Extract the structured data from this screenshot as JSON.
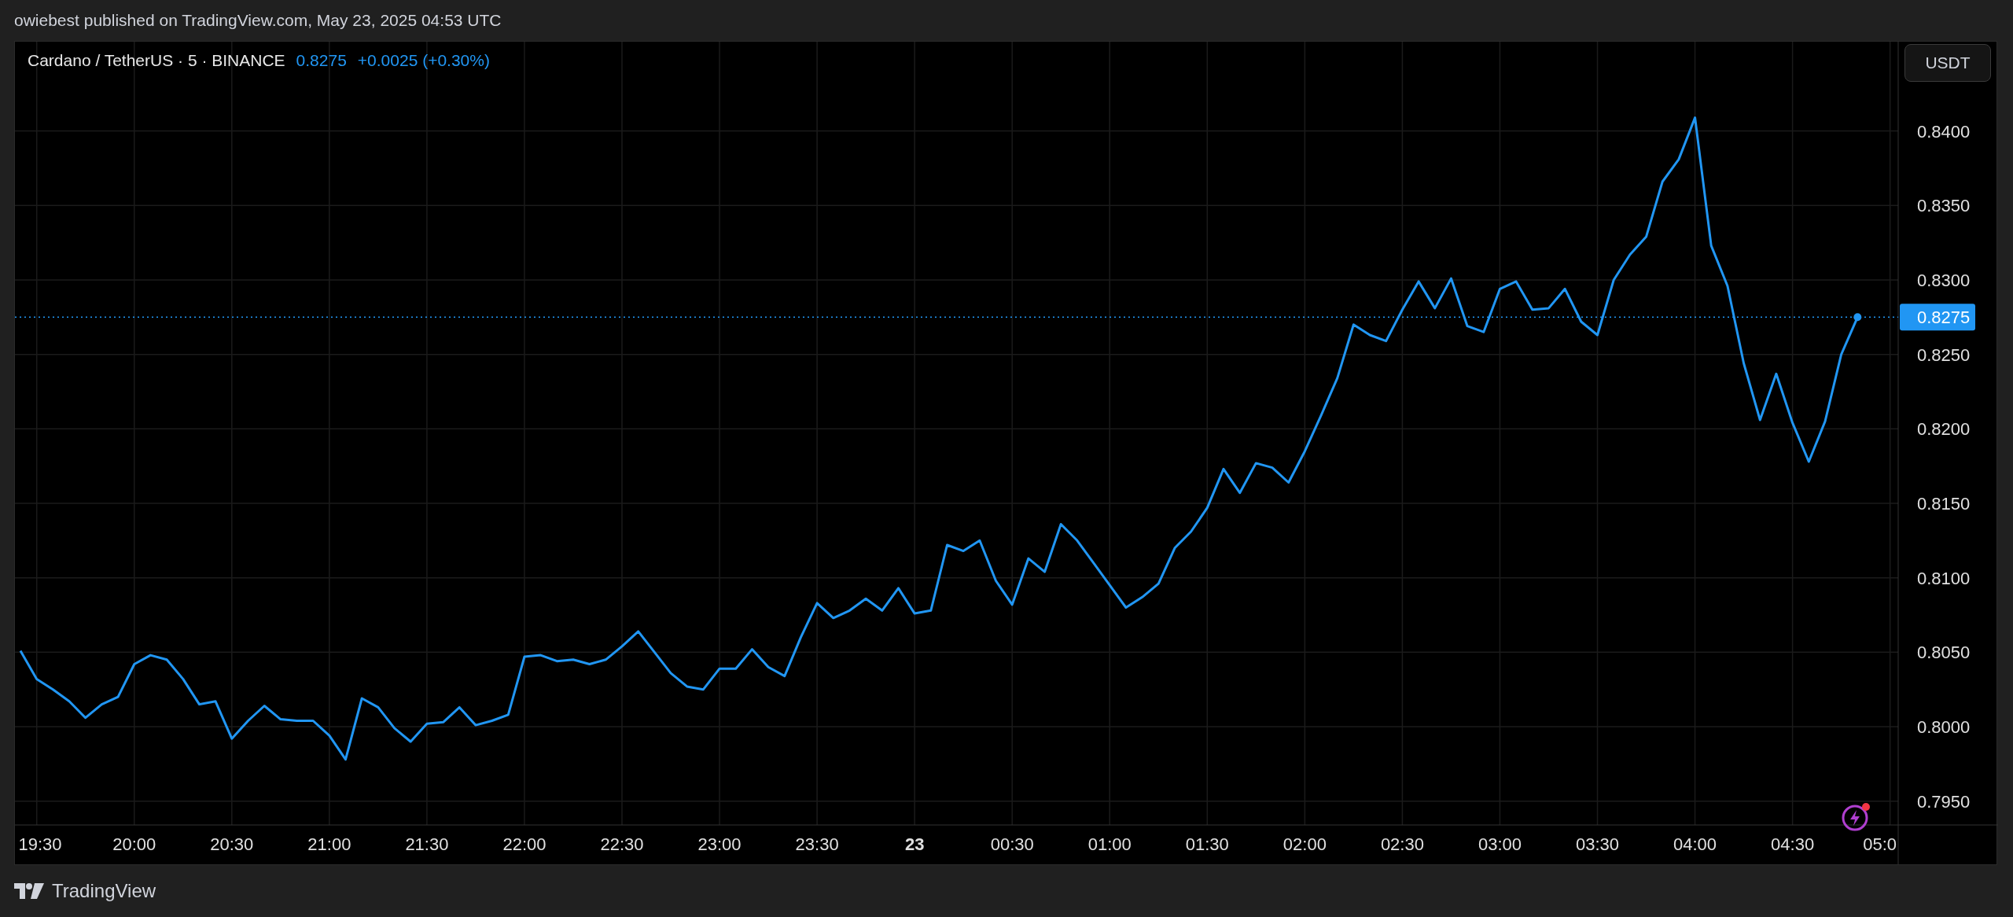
{
  "header": {
    "text": "owiebest published on TradingView.com, May 23, 2025 04:53 UTC"
  },
  "legend": {
    "symbol": "Cardano / TetherUS · 5 · BINANCE",
    "price": "0.8275",
    "change": "+0.0025 (+0.30%)"
  },
  "currency_button": "USDT",
  "chart": {
    "chart_data": {
      "type": "line",
      "grid": true,
      "categories": [
        null,
        "19:30",
        null,
        null,
        null,
        null,
        null,
        "20:00",
        null,
        null,
        null,
        null,
        null,
        "20:30",
        null,
        null,
        null,
        null,
        null,
        "21:00",
        null,
        null,
        null,
        null,
        null,
        "21:30",
        null,
        null,
        null,
        null,
        null,
        "22:00",
        null,
        null,
        null,
        null,
        null,
        "22:30",
        null,
        null,
        null,
        null,
        null,
        "23:00",
        null,
        null,
        null,
        null,
        null,
        "23:30",
        null,
        null,
        null,
        null,
        null,
        "23",
        null,
        null,
        null,
        null,
        null,
        "00:30",
        null,
        null,
        null,
        null,
        null,
        "01:00",
        null,
        null,
        null,
        null,
        null,
        "01:30",
        null,
        null,
        null,
        null,
        null,
        "02:00",
        null,
        null,
        null,
        null,
        null,
        "02:30",
        null,
        null,
        null,
        null,
        null,
        "03:00",
        null,
        null,
        null,
        null,
        null,
        "03:30",
        null,
        null,
        null,
        null,
        null,
        "04:00",
        null,
        null,
        null,
        null,
        null,
        "04:30",
        null,
        null,
        null,
        null,
        null,
        "05:0"
      ],
      "ylim": [
        0.7934,
        0.846
      ],
      "ref_lines": [
        {
          "axis": "y",
          "value": 0.8275,
          "label": "0.8275",
          "color": "#2196f3"
        }
      ],
      "series": [
        {
          "color": "#2196f3",
          "values": [
            0.8051,
            0.8032,
            0.8025,
            0.8017,
            0.8006,
            0.8015,
            0.802,
            0.8042,
            0.8048,
            0.8045,
            0.8032,
            0.8015,
            0.8017,
            0.7992,
            0.8004,
            0.8014,
            0.8005,
            0.8004,
            0.8004,
            0.7994,
            0.7978,
            0.8019,
            0.8013,
            0.7999,
            0.799,
            0.8002,
            0.8003,
            0.8013,
            0.8001,
            0.8004,
            0.8008,
            0.8047,
            0.8048,
            0.8044,
            0.8045,
            0.8042,
            0.8045,
            0.8054,
            0.8064,
            0.805,
            0.8036,
            0.8027,
            0.8025,
            0.8039,
            0.8039,
            0.8052,
            0.804,
            0.8034,
            0.806,
            0.8083,
            0.8073,
            0.8078,
            0.8086,
            0.8078,
            0.8093,
            0.8076,
            0.8078,
            0.8122,
            0.8118,
            0.8125,
            0.8098,
            0.8082,
            0.8113,
            0.8104,
            0.8136,
            0.8125,
            0.811,
            0.8095,
            0.808,
            0.8087,
            0.8096,
            0.812,
            0.8131,
            0.8147,
            0.8173,
            0.8157,
            0.8177,
            0.8174,
            0.8164,
            0.8185,
            0.8209,
            0.8234,
            0.827,
            0.8263,
            0.8259,
            0.828,
            0.8299,
            0.8281,
            0.8301,
            0.8269,
            0.8265,
            0.8294,
            0.8299,
            0.828,
            0.8281,
            0.8294,
            0.8272,
            0.8263,
            0.83,
            0.8317,
            0.8329,
            0.8366,
            0.8381,
            0.8409,
            0.8323,
            0.8296,
            0.8244,
            0.8206,
            0.8237,
            0.8204,
            0.8178,
            0.8205,
            0.825,
            0.8275,
            null,
            null
          ]
        }
      ],
      "yticks": [
        {
          "value": 0.795,
          "label": "0.7950"
        },
        {
          "value": 0.8,
          "label": "0.8000"
        },
        {
          "value": 0.805,
          "label": "0.8050"
        },
        {
          "value": 0.81,
          "label": "0.8100"
        },
        {
          "value": 0.815,
          "label": "0.8150"
        },
        {
          "value": 0.82,
          "label": "0.8200"
        },
        {
          "value": 0.825,
          "label": "0.8250"
        },
        {
          "value": 0.83,
          "label": "0.8300"
        },
        {
          "value": 0.835,
          "label": "0.8350"
        },
        {
          "value": 0.84,
          "label": "0.8400"
        }
      ]
    }
  },
  "footer": {
    "brand": "TradingView"
  }
}
